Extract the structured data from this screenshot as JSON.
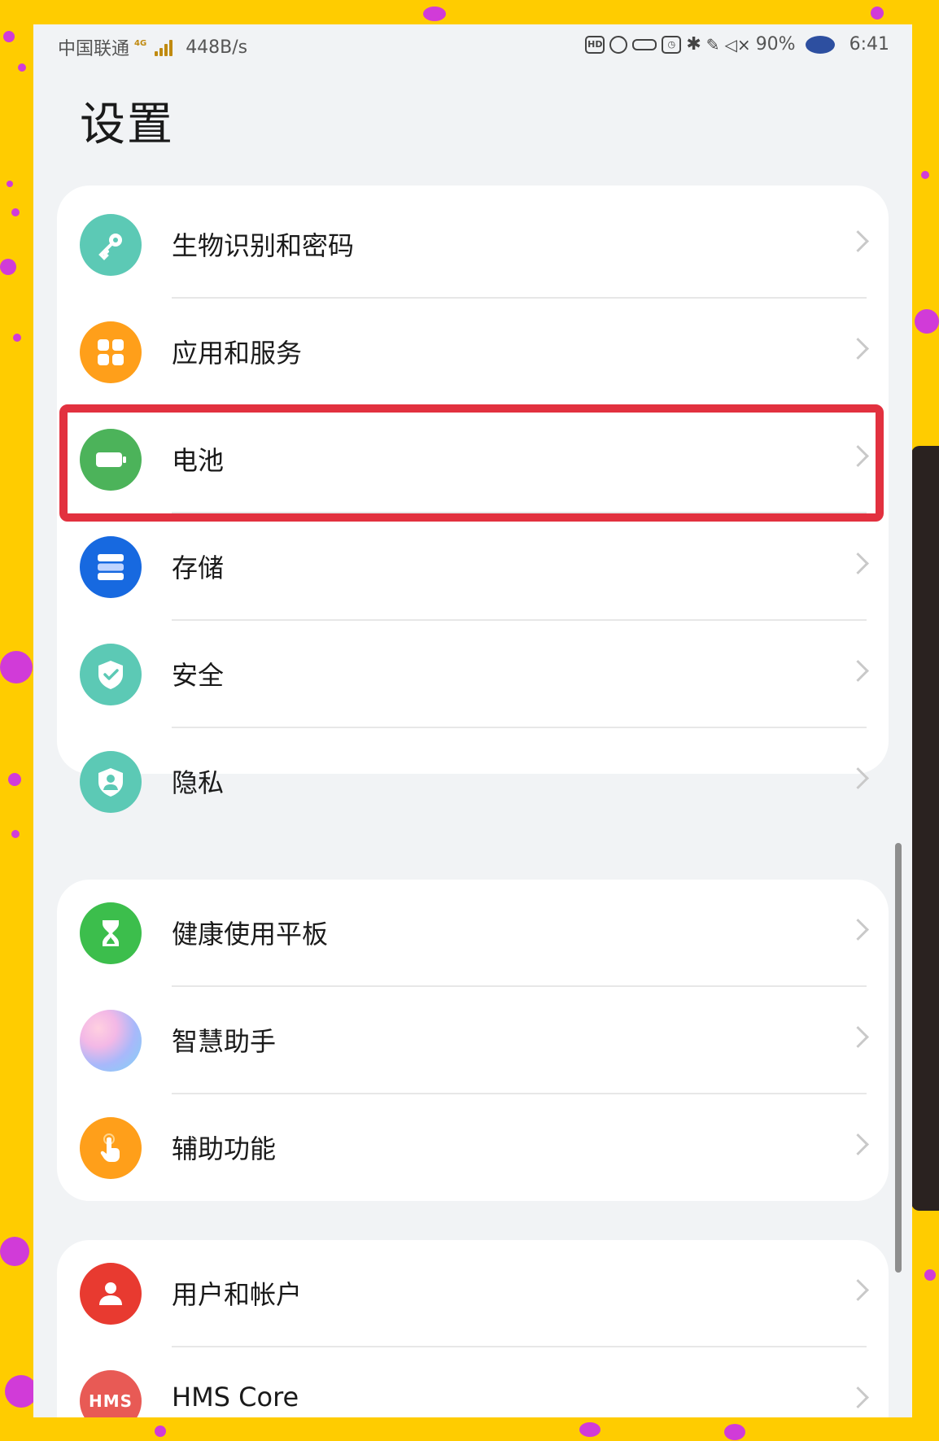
{
  "status_bar": {
    "carrier": "中国联通",
    "network_badge": "4G",
    "speed": "448B/s",
    "battery": "90%",
    "time": "6:41"
  },
  "page": {
    "title": "设置"
  },
  "groups": [
    {
      "items": [
        {
          "label": "生物识别和密码",
          "icon": "key-icon",
          "color": "#5CC9B5"
        },
        {
          "label": "应用和服务",
          "icon": "apps-grid-icon",
          "color": "#FF9F1A"
        },
        {
          "label": "电池",
          "icon": "battery-icon",
          "color": "#4CB35A",
          "highlighted": true
        },
        {
          "label": "存储",
          "icon": "storage-icon",
          "color": "#1769E0"
        },
        {
          "label": "安全",
          "icon": "shield-check-icon",
          "color": "#5CC9B5"
        },
        {
          "label": "隐私",
          "icon": "privacy-shield-icon",
          "color": "#5CC9B5"
        }
      ]
    },
    {
      "items": [
        {
          "label": "健康使用平板",
          "icon": "hourglass-icon",
          "color": "#3CBE4C"
        },
        {
          "label": "智慧助手",
          "icon": "assistant-icon",
          "color": "#B4A7F5"
        },
        {
          "label": "辅助功能",
          "icon": "hand-pointer-icon",
          "color": "#FF9F1A"
        }
      ]
    },
    {
      "items": [
        {
          "label": "用户和帐户",
          "icon": "user-icon",
          "color": "#E83A30"
        },
        {
          "label": "HMS Core",
          "icon": "hms-icon",
          "icon_text": "HMS",
          "color": "#E85A55"
        }
      ]
    }
  ],
  "highlight_color": "#E2313F"
}
